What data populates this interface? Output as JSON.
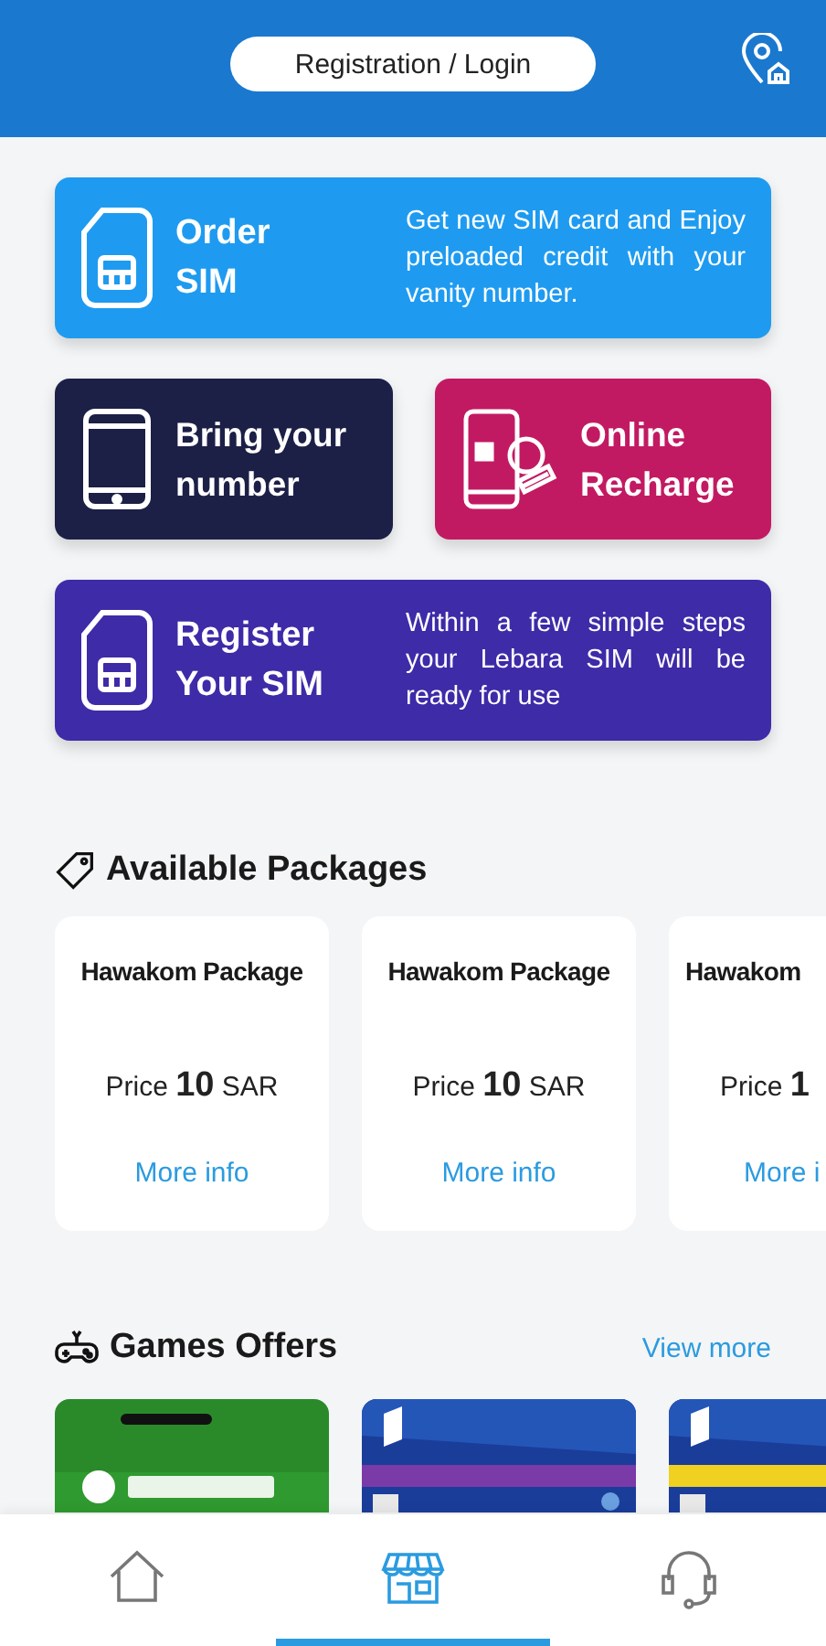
{
  "header": {
    "login_button": "Registration / Login"
  },
  "tiles": [
    {
      "kind": "sim",
      "color": "#1e9bf0",
      "title": "Order\nSIM",
      "description": "Get new SIM card and Enjoy preloaded credit with your vanity number."
    },
    {
      "kind": "phone",
      "color": "#1c1f46",
      "title": "Bring your number"
    },
    {
      "kind": "recharge",
      "color": "#c21a62",
      "title": "Online Recharge"
    },
    {
      "kind": "sim",
      "color": "#3d2ba8",
      "title": "Register Your SIM",
      "description": "Within a few simple steps your Lebara SIM will be ready for use"
    }
  ],
  "packages": {
    "title": "Available Packages",
    "items": [
      {
        "name": "Hawakom Package",
        "price": "Price **10** SAR",
        "link": "More info"
      },
      {
        "name": "Hawakom Package",
        "price": "Price **10** SAR",
        "link": "More info"
      },
      {
        "name": "Hawakom",
        "price": "Price **1**",
        "link": "More i"
      }
    ]
  },
  "games": {
    "title": "Games Offers",
    "view_more": "View more"
  },
  "bottom_nav": [
    {
      "kind": "home",
      "selected": false
    },
    {
      "kind": "store",
      "selected": true
    },
    {
      "kind": "support",
      "selected": false
    }
  ]
}
